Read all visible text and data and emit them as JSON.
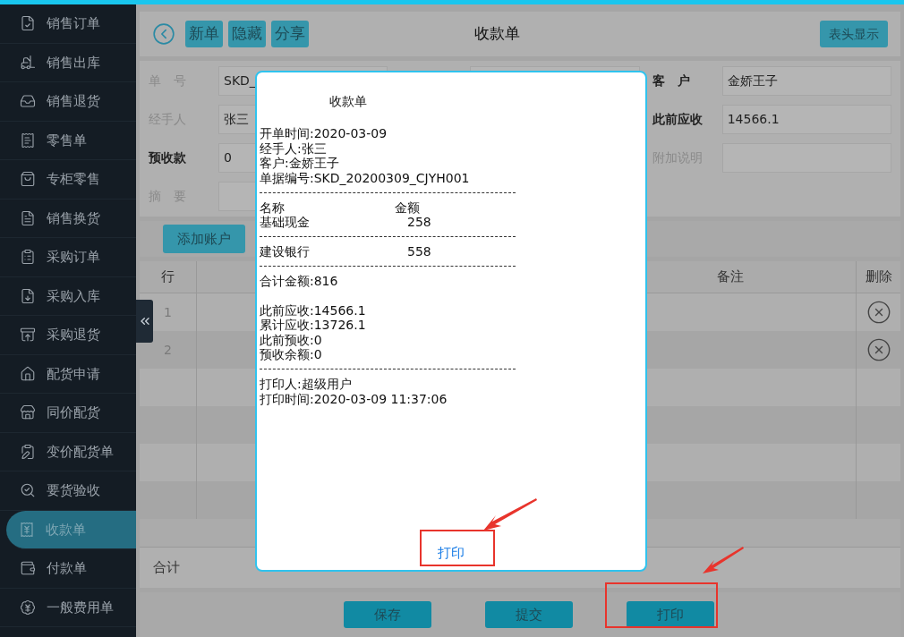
{
  "sidebar": {
    "items": [
      {
        "label": "销售订单",
        "selected": false
      },
      {
        "label": "销售出库",
        "selected": false
      },
      {
        "label": "销售退货",
        "selected": false
      },
      {
        "label": "零售单",
        "selected": false
      },
      {
        "label": "专柜零售",
        "selected": false
      },
      {
        "label": "销售换货",
        "selected": false
      },
      {
        "label": "采购订单",
        "selected": false
      },
      {
        "label": "采购入库",
        "selected": false
      },
      {
        "label": "采购退货",
        "selected": false
      },
      {
        "label": "配货申请",
        "selected": false
      },
      {
        "label": "同价配货",
        "selected": false
      },
      {
        "label": "变价配货单",
        "selected": false
      },
      {
        "label": "要货验收",
        "selected": false
      },
      {
        "label": "收款单",
        "selected": true
      },
      {
        "label": "付款单",
        "selected": false
      },
      {
        "label": "一般费用单",
        "selected": false
      }
    ]
  },
  "toolbar": {
    "buttons": [
      "新单",
      "隐藏",
      "分享"
    ],
    "title": "收款单",
    "right_button": "表头显示"
  },
  "form": {
    "rows": [
      [
        {
          "label": "单　号",
          "value": "SKD_",
          "required": false
        },
        null,
        {
          "label": "客　户",
          "value": "金娇王子",
          "required": true
        }
      ],
      [
        {
          "label": "经手人",
          "value": "张三",
          "required": false
        },
        null,
        {
          "label": "此前应收",
          "value": "14566.1",
          "required": true
        }
      ],
      [
        {
          "label": "预收款",
          "value": "0",
          "required": true
        },
        null,
        {
          "label": "附加说明",
          "required": false
        }
      ],
      [
        {
          "label": "摘　要",
          "required": false
        },
        null,
        null
      ]
    ]
  },
  "add_account_button": "添加账户",
  "table": {
    "columns": [
      "行",
      "备注",
      "删除"
    ],
    "rows": [
      "1",
      "2"
    ],
    "total_label": "合计"
  },
  "footer_buttons": [
    "保存",
    "提交",
    "打印"
  ],
  "dialog": {
    "lines": [
      {
        "kind": "heading",
        "text": "收款单"
      },
      {
        "kind": "blank"
      },
      {
        "kind": "text",
        "text": "开单时间:2020-03-09"
      },
      {
        "kind": "text",
        "text": "经手人:张三"
      },
      {
        "kind": "text",
        "text": "客户:金娇王子"
      },
      {
        "kind": "text",
        "text": "单据编号:SKD_20200309_CJYH001"
      },
      {
        "kind": "rule"
      },
      {
        "kind": "column_heads",
        "cells": [
          "名称",
          "金额"
        ]
      },
      {
        "kind": "amount_row",
        "cells": [
          "基础现金",
          "258"
        ]
      },
      {
        "kind": "rule"
      },
      {
        "kind": "amount_row",
        "cells": [
          "建设银行",
          "558"
        ]
      },
      {
        "kind": "rule"
      },
      {
        "kind": "text",
        "text": "合计金额:816"
      },
      {
        "kind": "blank"
      },
      {
        "kind": "text",
        "text": "此前应收:14566.1"
      },
      {
        "kind": "text",
        "text": "累计应收:13726.1"
      },
      {
        "kind": "text",
        "text": "此前预收:0"
      },
      {
        "kind": "text",
        "text": "预收余额:0"
      },
      {
        "kind": "rule"
      },
      {
        "kind": "text",
        "text": "打印人:超级用户"
      },
      {
        "kind": "text",
        "text": "打印时间:2020-03-09 11:37:06"
      }
    ],
    "print_link": "打印"
  }
}
